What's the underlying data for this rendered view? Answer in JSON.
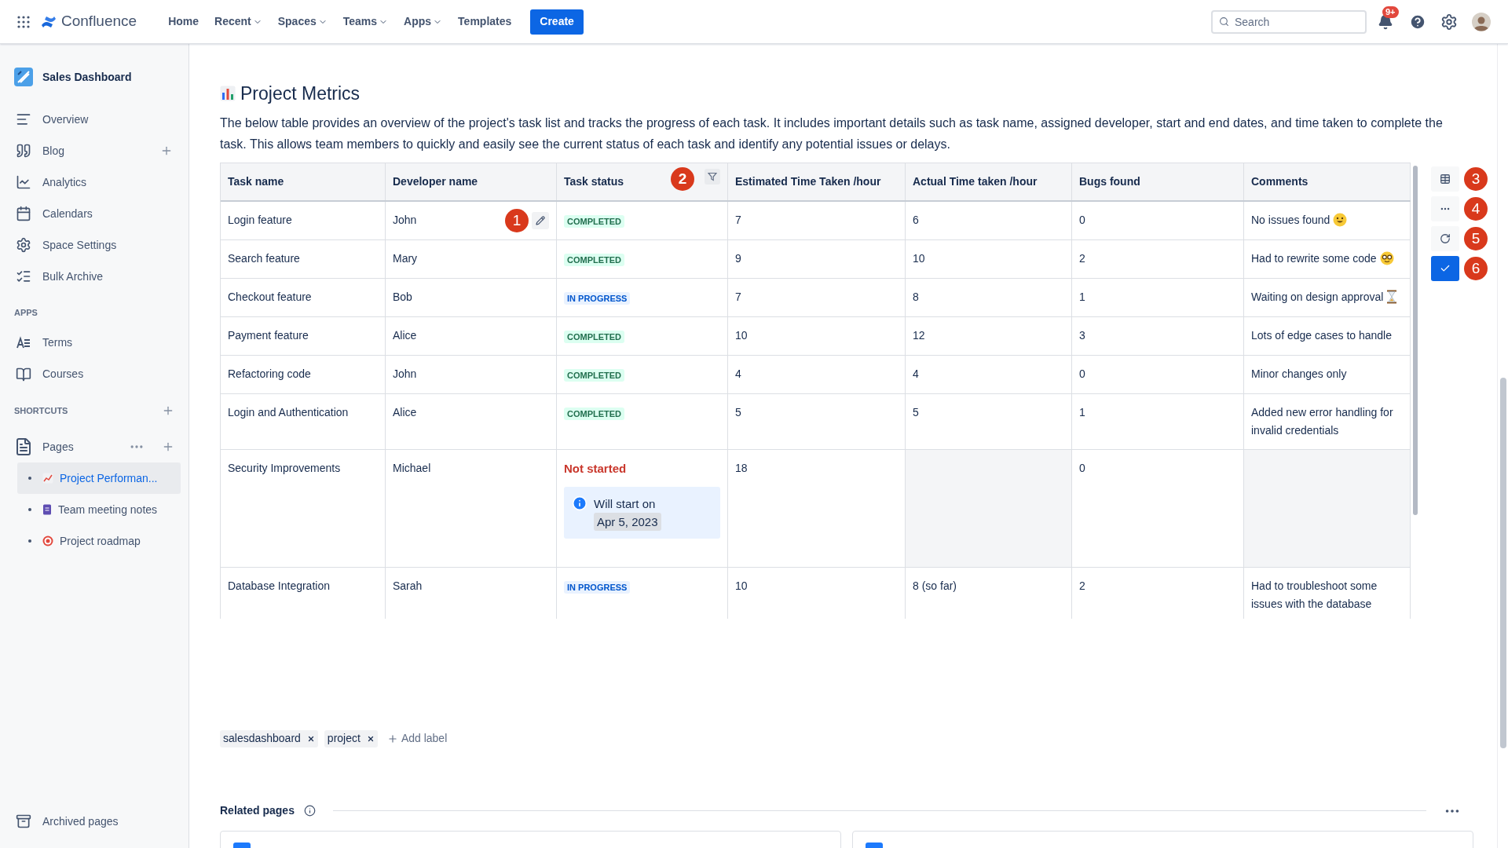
{
  "topbar": {
    "product": "Confluence",
    "nav": [
      {
        "label": "Home",
        "dropdown": false
      },
      {
        "label": "Recent",
        "dropdown": true
      },
      {
        "label": "Spaces",
        "dropdown": true
      },
      {
        "label": "Teams",
        "dropdown": true
      },
      {
        "label": "Apps",
        "dropdown": true
      },
      {
        "label": "Templates",
        "dropdown": false
      }
    ],
    "create": "Create",
    "search": {
      "placeholder": "Search"
    },
    "notification_count": "9+"
  },
  "sidebar": {
    "space": "Sales Dashboard",
    "items": [
      {
        "label": "Overview",
        "kind": "overview",
        "addable": false
      },
      {
        "label": "Blog",
        "kind": "blog",
        "addable": true
      },
      {
        "label": "Analytics",
        "kind": "analytics",
        "addable": false
      },
      {
        "label": "Calendars",
        "kind": "calendar",
        "addable": false
      },
      {
        "label": "Space Settings",
        "kind": "settings",
        "addable": false
      },
      {
        "label": "Bulk Archive",
        "kind": "archive_list",
        "addable": false
      }
    ],
    "apps_heading": "APPS",
    "apps": [
      {
        "label": "Terms",
        "kind": "terms"
      },
      {
        "label": "Courses",
        "kind": "courses"
      }
    ],
    "shortcuts_heading": "SHORTCUTS",
    "pages_label": "Pages",
    "pages": [
      {
        "label": "Project Performan...",
        "kind": "chart",
        "selected": true
      },
      {
        "label": "Team meeting notes",
        "kind": "note",
        "selected": false
      },
      {
        "label": "Project roadmap",
        "kind": "target",
        "selected": false
      }
    ],
    "archived": "Archived pages"
  },
  "page": {
    "heading": "Project Metrics",
    "intro": "The below table provides an overview of the project's task list and tracks the progress of each task. It includes important details such as task name, assigned developer, start and end dates, and time taken to complete the task. This allows team members to quickly and easily see the current status of each task and identify any potential issues or delays.",
    "table": {
      "columns": [
        "Task name",
        "Developer name",
        "Task status",
        "Estimated Time Taken /hour",
        "Actual Time taken /hour",
        "Bugs found",
        "Comments"
      ],
      "rows": [
        {
          "cells": [
            {
              "kind": "text",
              "text": "Login feature"
            },
            {
              "kind": "text",
              "text": "John",
              "annotation": "1"
            },
            {
              "kind": "completed",
              "text": "COMPLETED"
            },
            {
              "kind": "text",
              "text": "7"
            },
            {
              "kind": "text",
              "text": "6"
            },
            {
              "kind": "text",
              "text": "0"
            },
            {
              "kind": "smiley",
              "text": "No issues found"
            }
          ]
        },
        {
          "cells": [
            {
              "kind": "text",
              "text": "Search feature"
            },
            {
              "kind": "text",
              "text": "Mary"
            },
            {
              "kind": "completed",
              "text": "COMPLETED"
            },
            {
              "kind": "text",
              "text": "9"
            },
            {
              "kind": "text",
              "text": "10"
            },
            {
              "kind": "text",
              "text": "2"
            },
            {
              "kind": "nerd",
              "text": "Had to rewrite some code"
            }
          ]
        },
        {
          "cells": [
            {
              "kind": "text",
              "text": "Checkout feature"
            },
            {
              "kind": "text",
              "text": "Bob"
            },
            {
              "kind": "in_progress",
              "text": "IN PROGRESS"
            },
            {
              "kind": "text",
              "text": "7"
            },
            {
              "kind": "text",
              "text": "8"
            },
            {
              "kind": "text",
              "text": "1"
            },
            {
              "kind": "hourglass",
              "text": "Waiting on design approval"
            }
          ]
        },
        {
          "cells": [
            {
              "kind": "text",
              "text": "Payment feature"
            },
            {
              "kind": "text",
              "text": "Alice"
            },
            {
              "kind": "completed",
              "text": "COMPLETED"
            },
            {
              "kind": "text",
              "text": "10"
            },
            {
              "kind": "text",
              "text": "12"
            },
            {
              "kind": "text",
              "text": "3"
            },
            {
              "kind": "text",
              "text": "Lots of edge cases to handle"
            }
          ]
        },
        {
          "cells": [
            {
              "kind": "text",
              "text": "Refactoring code"
            },
            {
              "kind": "text",
              "text": "John"
            },
            {
              "kind": "completed",
              "text": "COMPLETED"
            },
            {
              "kind": "text",
              "text": "4"
            },
            {
              "kind": "text",
              "text": "4"
            },
            {
              "kind": "text",
              "text": "0"
            },
            {
              "kind": "text",
              "text": "Minor changes only"
            }
          ]
        },
        {
          "cells": [
            {
              "kind": "text",
              "text": "Login and Authentication"
            },
            {
              "kind": "text",
              "text": "Alice"
            },
            {
              "kind": "completed",
              "text": "COMPLETED"
            },
            {
              "kind": "text",
              "text": "5"
            },
            {
              "kind": "text",
              "text": "5"
            },
            {
              "kind": "text",
              "text": "1"
            },
            {
              "kind": "text",
              "text": "Added new error handling for invalid credentials"
            }
          ]
        },
        {
          "cells": [
            {
              "kind": "text",
              "text": "Security Improvements"
            },
            {
              "kind": "text",
              "text": "Michael"
            },
            {
              "kind": "not_started",
              "text": "Not started",
              "note": "Will start on",
              "date": "Apr 5, 2023"
            },
            {
              "kind": "text",
              "text": "18"
            },
            {
              "kind": "blank"
            },
            {
              "kind": "text",
              "text": "0"
            },
            {
              "kind": "blank"
            }
          ]
        },
        {
          "cells": [
            {
              "kind": "text",
              "text": "Database Integration"
            },
            {
              "kind": "text",
              "text": "Sarah"
            },
            {
              "kind": "in_progress",
              "text": "IN PROGRESS"
            },
            {
              "kind": "text",
              "text": "10"
            },
            {
              "kind": "text",
              "text": "8 (so far)"
            },
            {
              "kind": "text",
              "text": "2"
            },
            {
              "kind": "text",
              "text": "Had to troubleshoot some issues with the database"
            }
          ]
        }
      ],
      "status_annotation": "2",
      "toolbar": [
        {
          "kind": "table",
          "annotation": "3",
          "selected": false
        },
        {
          "kind": "more",
          "annotation": "4",
          "selected": false
        },
        {
          "kind": "refresh",
          "annotation": "5",
          "selected": false
        },
        {
          "kind": "check",
          "annotation": "6",
          "selected": true
        }
      ]
    },
    "labels": [
      "salesdashboard",
      "project"
    ],
    "add_label": "Add label",
    "related_title": "Related pages"
  }
}
